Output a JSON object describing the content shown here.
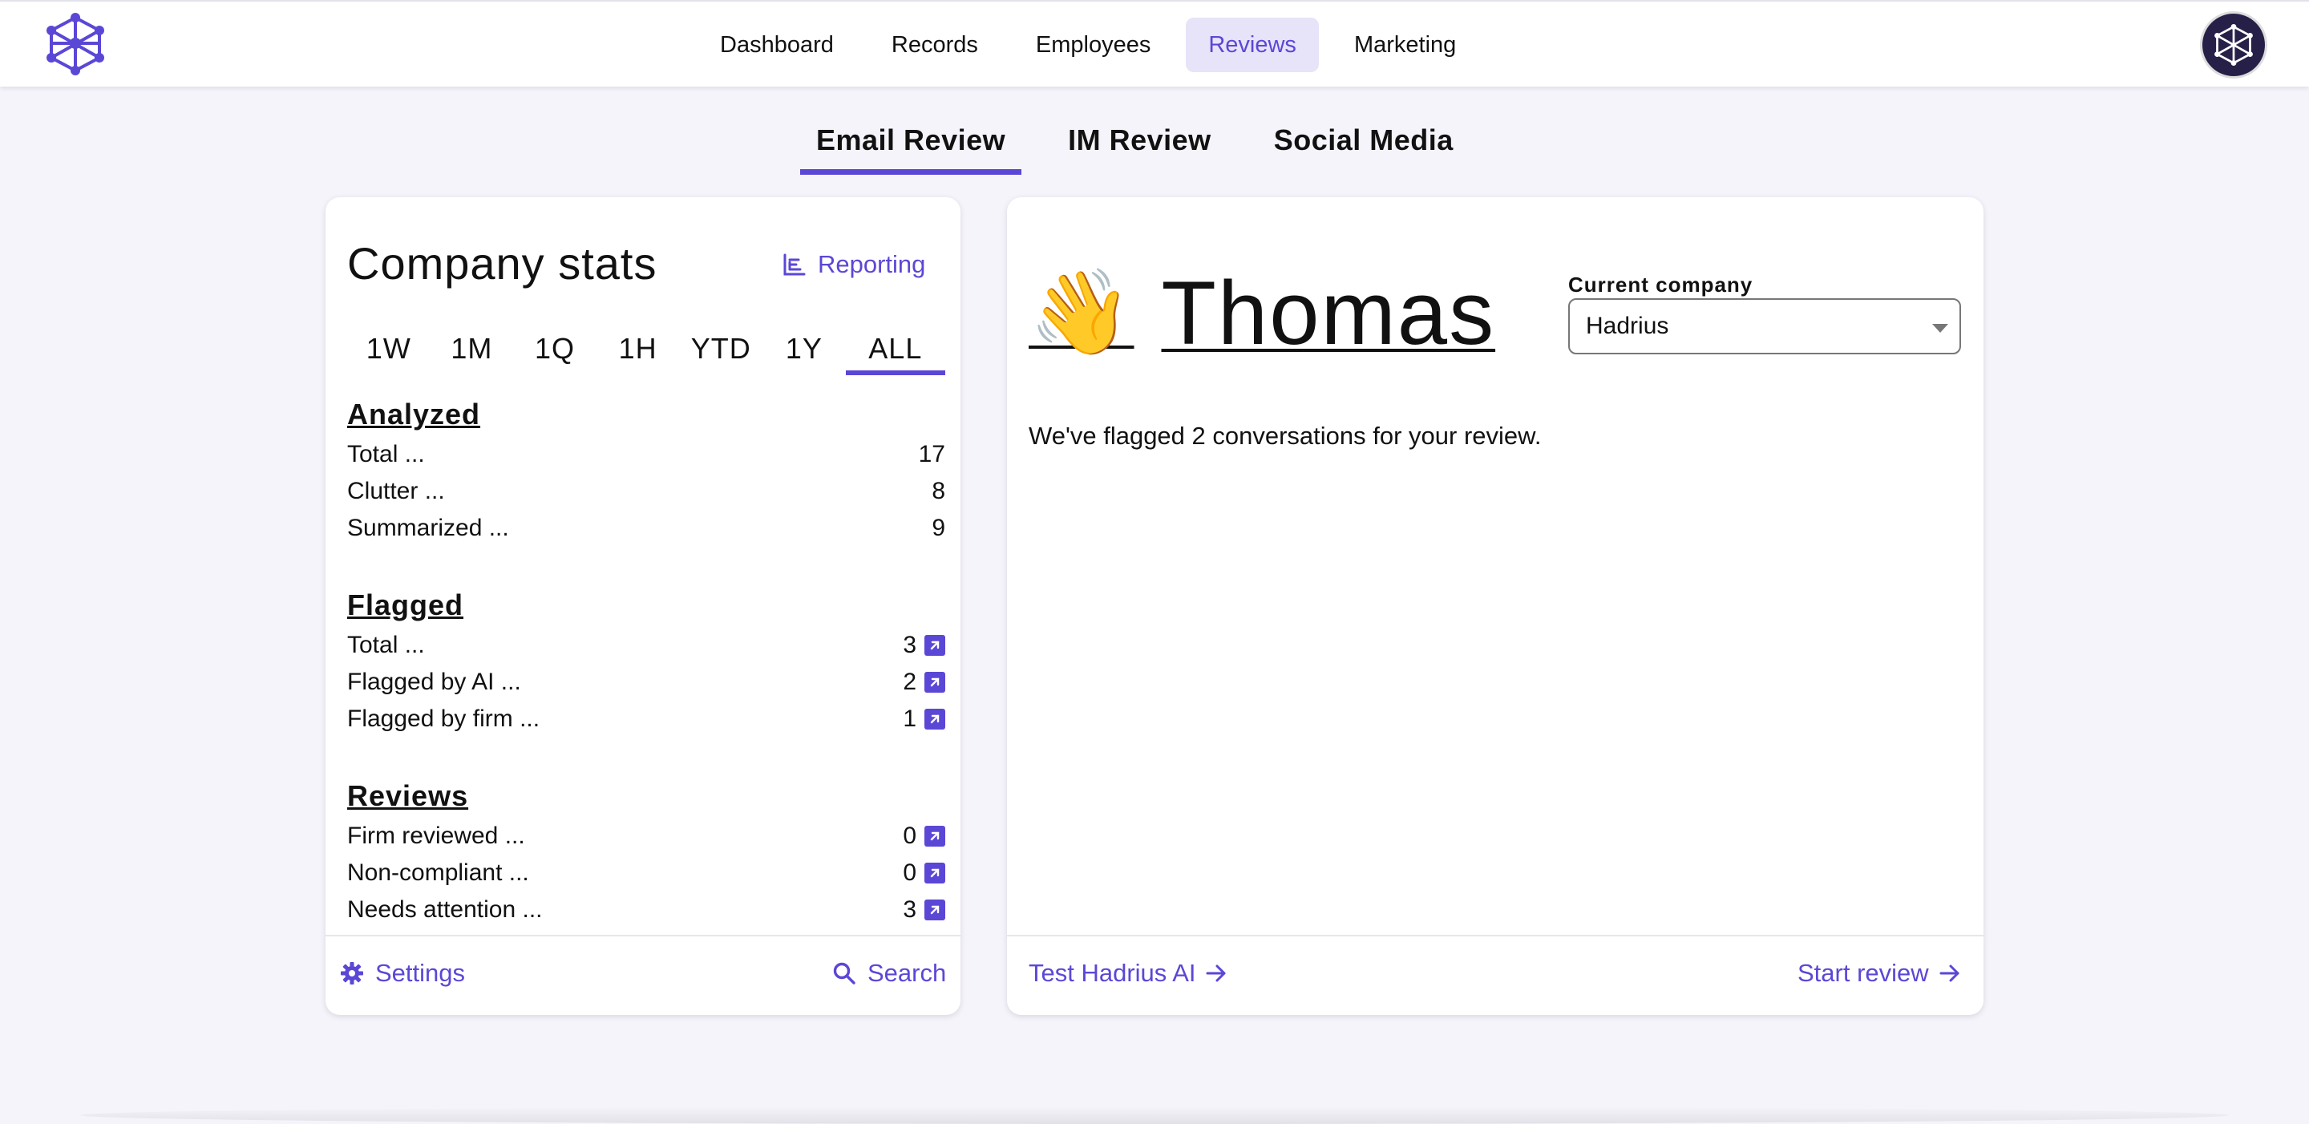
{
  "nav": {
    "items": [
      {
        "label": "Dashboard",
        "active": false
      },
      {
        "label": "Records",
        "active": false
      },
      {
        "label": "Employees",
        "active": false
      },
      {
        "label": "Reviews",
        "active": true
      },
      {
        "label": "Marketing",
        "active": false
      }
    ]
  },
  "subtabs": [
    {
      "label": "Email Review",
      "active": true
    },
    {
      "label": "IM Review",
      "active": false
    },
    {
      "label": "Social Media",
      "active": false
    }
  ],
  "stats": {
    "title": "Company stats",
    "reporting_label": "Reporting",
    "periods": [
      "1W",
      "1M",
      "1Q",
      "1H",
      "YTD",
      "1Y",
      "ALL"
    ],
    "active_period": "ALL",
    "analyzed": {
      "title": "Analyzed",
      "rows": [
        {
          "label": "Total ...",
          "value": "17"
        },
        {
          "label": "Clutter ...",
          "value": "8"
        },
        {
          "label": "Summarized ...",
          "value": "9"
        }
      ]
    },
    "flagged": {
      "title": "Flagged",
      "rows": [
        {
          "label": "Total ...",
          "value": "3"
        },
        {
          "label": "Flagged by AI ...",
          "value": "2"
        },
        {
          "label": "Flagged by firm ...",
          "value": "1"
        }
      ]
    },
    "reviews": {
      "title": "Reviews",
      "rows": [
        {
          "label": "Firm reviewed ...",
          "value": "0"
        },
        {
          "label": "Non-compliant ...",
          "value": "0"
        },
        {
          "label": "Needs attention ...",
          "value": "3"
        }
      ]
    },
    "footer": {
      "settings_label": "Settings",
      "search_label": "Search"
    }
  },
  "welcome": {
    "wave": "👋",
    "name": "Thomas",
    "company_label": "Current company",
    "company_value": "Hadrius",
    "message": "We've flagged 2 conversations for your review.",
    "footer": {
      "test_label": "Test Hadrius AI",
      "start_label": "Start review"
    }
  },
  "colors": {
    "accent": "#5b47d6",
    "accent_soft": "#e7e3f8",
    "background": "#f5f4fb"
  },
  "icons": [
    "logo-icon",
    "avatar-icon",
    "chart-icon",
    "arrow-up-right-icon",
    "gear-icon",
    "search-icon",
    "arrow-right-icon",
    "caret-down-icon"
  ]
}
